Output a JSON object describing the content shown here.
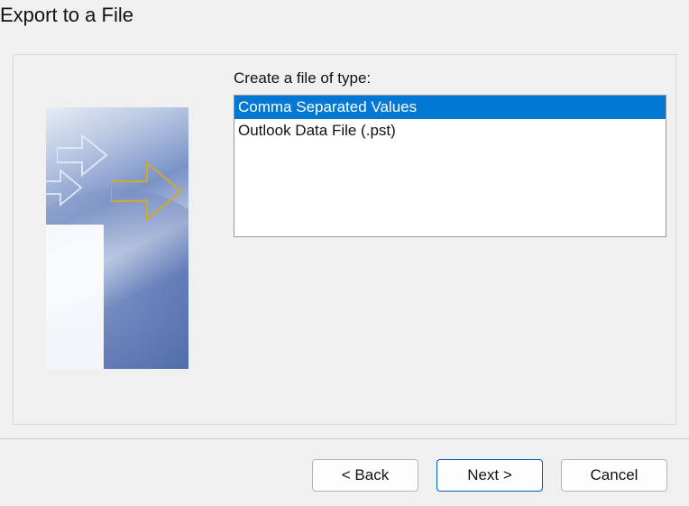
{
  "title": "Export to a File",
  "label": "Create a file of type:",
  "file_types": [
    {
      "label": "Comma Separated Values",
      "selected": true
    },
    {
      "label": "Outlook Data File (.pst)",
      "selected": false
    }
  ],
  "buttons": {
    "back": "< Back",
    "next": "Next >",
    "cancel": "Cancel"
  }
}
